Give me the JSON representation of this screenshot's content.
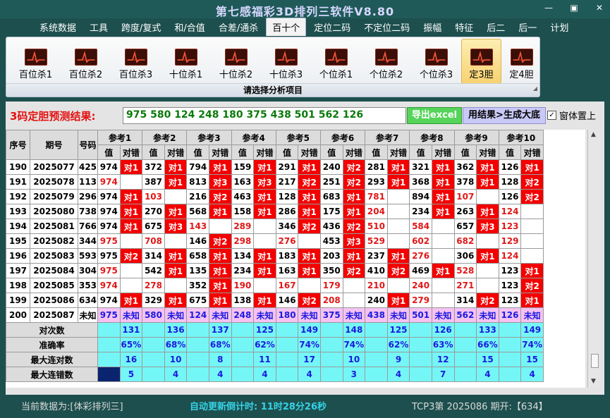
{
  "window": {
    "title": "第七感福彩3D排列三软件V8.80",
    "min": "—",
    "restore": "▣",
    "close": "✕"
  },
  "menu": [
    "系统数据",
    "工具",
    "跨度/复式",
    "和/合值",
    "合差/通杀",
    "百十个",
    "定位二码",
    "不定位二码",
    "振幅",
    "特征",
    "后二",
    "后一",
    "计划"
  ],
  "menu_active": "百十个",
  "ribbon": {
    "items": [
      "百位杀1",
      "百位杀2",
      "百位杀3",
      "十位杀1",
      "十位杀2",
      "十位杀3",
      "个位杀1",
      "个位杀2",
      "个位杀3",
      "定3胆",
      "定4胆"
    ],
    "active": "定3胆",
    "caption": "请选择分析项目"
  },
  "prediction": {
    "label": "3码定胆预测结果:",
    "value": "975 580 124 248 180 375 438 501 562 126",
    "export_button": "导出excel",
    "generate_button": "用结果>生成大底",
    "checkbox_label": "窗体置上",
    "checkbox_checked": true
  },
  "table": {
    "headers": {
      "no": "序号",
      "period": "期号",
      "code": "号码",
      "val": "值",
      "result": "对错"
    },
    "refs": [
      "参考1",
      "参考2",
      "参考3",
      "参考4",
      "参考5",
      "参考6",
      "参考7",
      "参考8",
      "参考9",
      "参考10"
    ],
    "rows": [
      {
        "no": "190",
        "period": "2025077",
        "code": "425",
        "cells": [
          [
            "974",
            "对1"
          ],
          [
            "372",
            "对1"
          ],
          [
            "794",
            "对1"
          ],
          [
            "159",
            "对1"
          ],
          [
            "291",
            "对1"
          ],
          [
            "240",
            "对2"
          ],
          [
            "281",
            "对1"
          ],
          [
            "321",
            "对1"
          ],
          [
            "362",
            "对1"
          ],
          [
            "126",
            "对1"
          ]
        ]
      },
      {
        "no": "191",
        "period": "2025078",
        "code": "113",
        "cells": [
          [
            "974",
            ""
          ],
          [
            "387",
            "对1"
          ],
          [
            "813",
            "对3"
          ],
          [
            "163",
            "对3"
          ],
          [
            "217",
            "对2"
          ],
          [
            "251",
            "对2"
          ],
          [
            "293",
            "对1"
          ],
          [
            "368",
            "对1"
          ],
          [
            "378",
            "对1"
          ],
          [
            "128",
            "对2"
          ]
        ]
      },
      {
        "no": "192",
        "period": "2025079",
        "code": "296",
        "cells": [
          [
            "974",
            "对1"
          ],
          [
            "103",
            ""
          ],
          [
            "216",
            "对2"
          ],
          [
            "463",
            "对1"
          ],
          [
            "128",
            "对1"
          ],
          [
            "683",
            "对1"
          ],
          [
            "781",
            ""
          ],
          [
            "894",
            "对1"
          ],
          [
            "107",
            ""
          ],
          [
            "126",
            "对2"
          ]
        ]
      },
      {
        "no": "193",
        "period": "2025080",
        "code": "738",
        "cells": [
          [
            "974",
            "对1"
          ],
          [
            "270",
            "对1"
          ],
          [
            "568",
            "对1"
          ],
          [
            "158",
            "对1"
          ],
          [
            "286",
            "对1"
          ],
          [
            "175",
            "对1"
          ],
          [
            "204",
            ""
          ],
          [
            "234",
            "对1"
          ],
          [
            "263",
            "对1"
          ],
          [
            "124",
            ""
          ]
        ]
      },
      {
        "no": "194",
        "period": "2025081",
        "code": "766",
        "cells": [
          [
            "974",
            "对1"
          ],
          [
            "675",
            "对3"
          ],
          [
            "143",
            ""
          ],
          [
            "289",
            ""
          ],
          [
            "346",
            "对2"
          ],
          [
            "436",
            "对2"
          ],
          [
            "510",
            ""
          ],
          [
            "584",
            ""
          ],
          [
            "657",
            "对3"
          ],
          [
            "123",
            ""
          ]
        ]
      },
      {
        "no": "195",
        "period": "2025082",
        "code": "344",
        "cells": [
          [
            "975",
            ""
          ],
          [
            "708",
            ""
          ],
          [
            "146",
            "对2"
          ],
          [
            "298",
            ""
          ],
          [
            "276",
            ""
          ],
          [
            "453",
            "对3"
          ],
          [
            "529",
            ""
          ],
          [
            "602",
            ""
          ],
          [
            "682",
            ""
          ],
          [
            "129",
            ""
          ]
        ]
      },
      {
        "no": "196",
        "period": "2025083",
        "code": "593",
        "cells": [
          [
            "975",
            "对2"
          ],
          [
            "314",
            "对1"
          ],
          [
            "658",
            "对1"
          ],
          [
            "134",
            "对1"
          ],
          [
            "183",
            "对1"
          ],
          [
            "203",
            "对1"
          ],
          [
            "237",
            "对1"
          ],
          [
            "276",
            ""
          ],
          [
            "306",
            "对1"
          ],
          [
            "124",
            ""
          ]
        ]
      },
      {
        "no": "197",
        "period": "2025084",
        "code": "304",
        "cells": [
          [
            "975",
            ""
          ],
          [
            "542",
            "对1"
          ],
          [
            "135",
            "对1"
          ],
          [
            "234",
            "对1"
          ],
          [
            "163",
            "对1"
          ],
          [
            "350",
            "对2"
          ],
          [
            "410",
            "对2"
          ],
          [
            "469",
            "对1"
          ],
          [
            "528",
            ""
          ],
          [
            "123",
            "对1"
          ]
        ]
      },
      {
        "no": "198",
        "period": "2025085",
        "code": "353",
        "cells": [
          [
            "974",
            ""
          ],
          [
            "278",
            ""
          ],
          [
            "352",
            "对1"
          ],
          [
            "190",
            ""
          ],
          [
            "167",
            ""
          ],
          [
            "179",
            ""
          ],
          [
            "210",
            ""
          ],
          [
            "240",
            ""
          ],
          [
            "271",
            ""
          ],
          [
            "123",
            "对2"
          ]
        ]
      },
      {
        "no": "199",
        "period": "2025086",
        "code": "634",
        "cells": [
          [
            "974",
            "对1"
          ],
          [
            "329",
            "对1"
          ],
          [
            "675",
            "对1"
          ],
          [
            "138",
            "对1"
          ],
          [
            "146",
            "对2"
          ],
          [
            "208",
            ""
          ],
          [
            "240",
            "对1"
          ],
          [
            "279",
            ""
          ],
          [
            "314",
            "对2"
          ],
          [
            "123",
            "对1"
          ]
        ]
      }
    ],
    "last_row": {
      "no": "200",
      "period": "2025087",
      "code": "未知",
      "cells": [
        [
          "975",
          "未知"
        ],
        [
          "580",
          "未知"
        ],
        [
          "124",
          "未知"
        ],
        [
          "248",
          "未知"
        ],
        [
          "180",
          "未知"
        ],
        [
          "375",
          "未知"
        ],
        [
          "438",
          "未知"
        ],
        [
          "501",
          "未知"
        ],
        [
          "562",
          "未知"
        ],
        [
          "126",
          "未知"
        ]
      ]
    },
    "stats": [
      {
        "label": "对次数",
        "values": [
          "131",
          "136",
          "137",
          "125",
          "149",
          "148",
          "125",
          "126",
          "133",
          "149"
        ]
      },
      {
        "label": "准确率",
        "values": [
          "65%",
          "68%",
          "68%",
          "62%",
          "74%",
          "74%",
          "62%",
          "63%",
          "66%",
          "74%"
        ]
      },
      {
        "label": "最大连对数",
        "values": [
          "16",
          "10",
          "8",
          "11",
          "17",
          "10",
          "9",
          "12",
          "15",
          "15"
        ]
      },
      {
        "label": "最大连错数",
        "values": [
          "5",
          "4",
          "4",
          "4",
          "4",
          "3",
          "4",
          "7",
          "4",
          "4"
        ]
      }
    ]
  },
  "status": {
    "data_source": "当前数据为:[体彩排列三]",
    "countdown": "自动更新倒计时:  11时28分26秒",
    "draw_info": "TCP3第 2025086 期开:【634】"
  }
}
